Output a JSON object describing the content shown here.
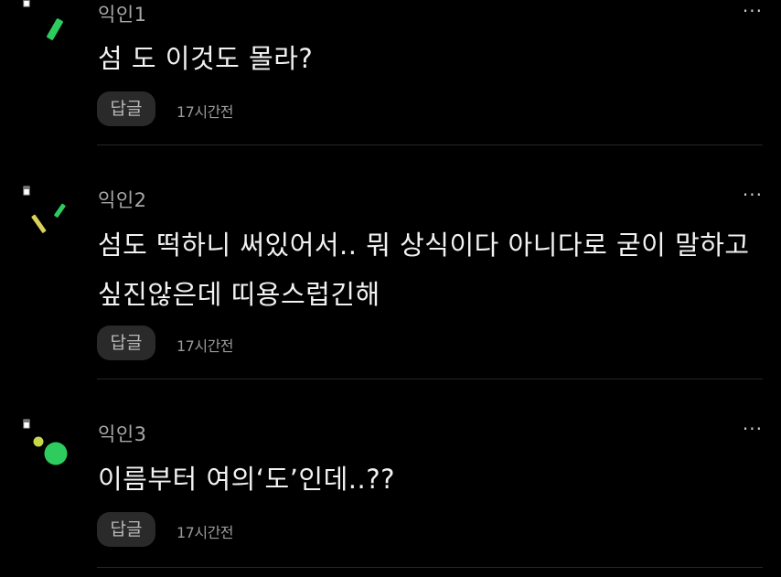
{
  "comments": [
    {
      "author": "익인1",
      "text": "섬 도 이것도 몰라?",
      "reply_label": "답글",
      "time": "17시간전",
      "more_label": "···",
      "avatar_icon": "confetti-avatar-icon"
    },
    {
      "author": "익인2",
      "text": "섬도 떡하니 써있어서.. 뭐 상식이다 아니다로 굳이 말하고 싶진않은데 띠용스럽긴해",
      "reply_label": "답글",
      "time": "17시간전",
      "more_label": "···",
      "avatar_icon": "confetti-avatar-icon"
    },
    {
      "author": "익인3",
      "text": "이름부터 여의‘도’인데..??",
      "reply_label": "답글",
      "time": "17시간전",
      "more_label": "···",
      "avatar_icon": "dots-avatar-icon"
    }
  ],
  "colors": {
    "background": "#000000",
    "accent_green": "#2ecc5e",
    "accent_yellow": "#d9d25a",
    "reply_bg": "#2a2a2a"
  }
}
